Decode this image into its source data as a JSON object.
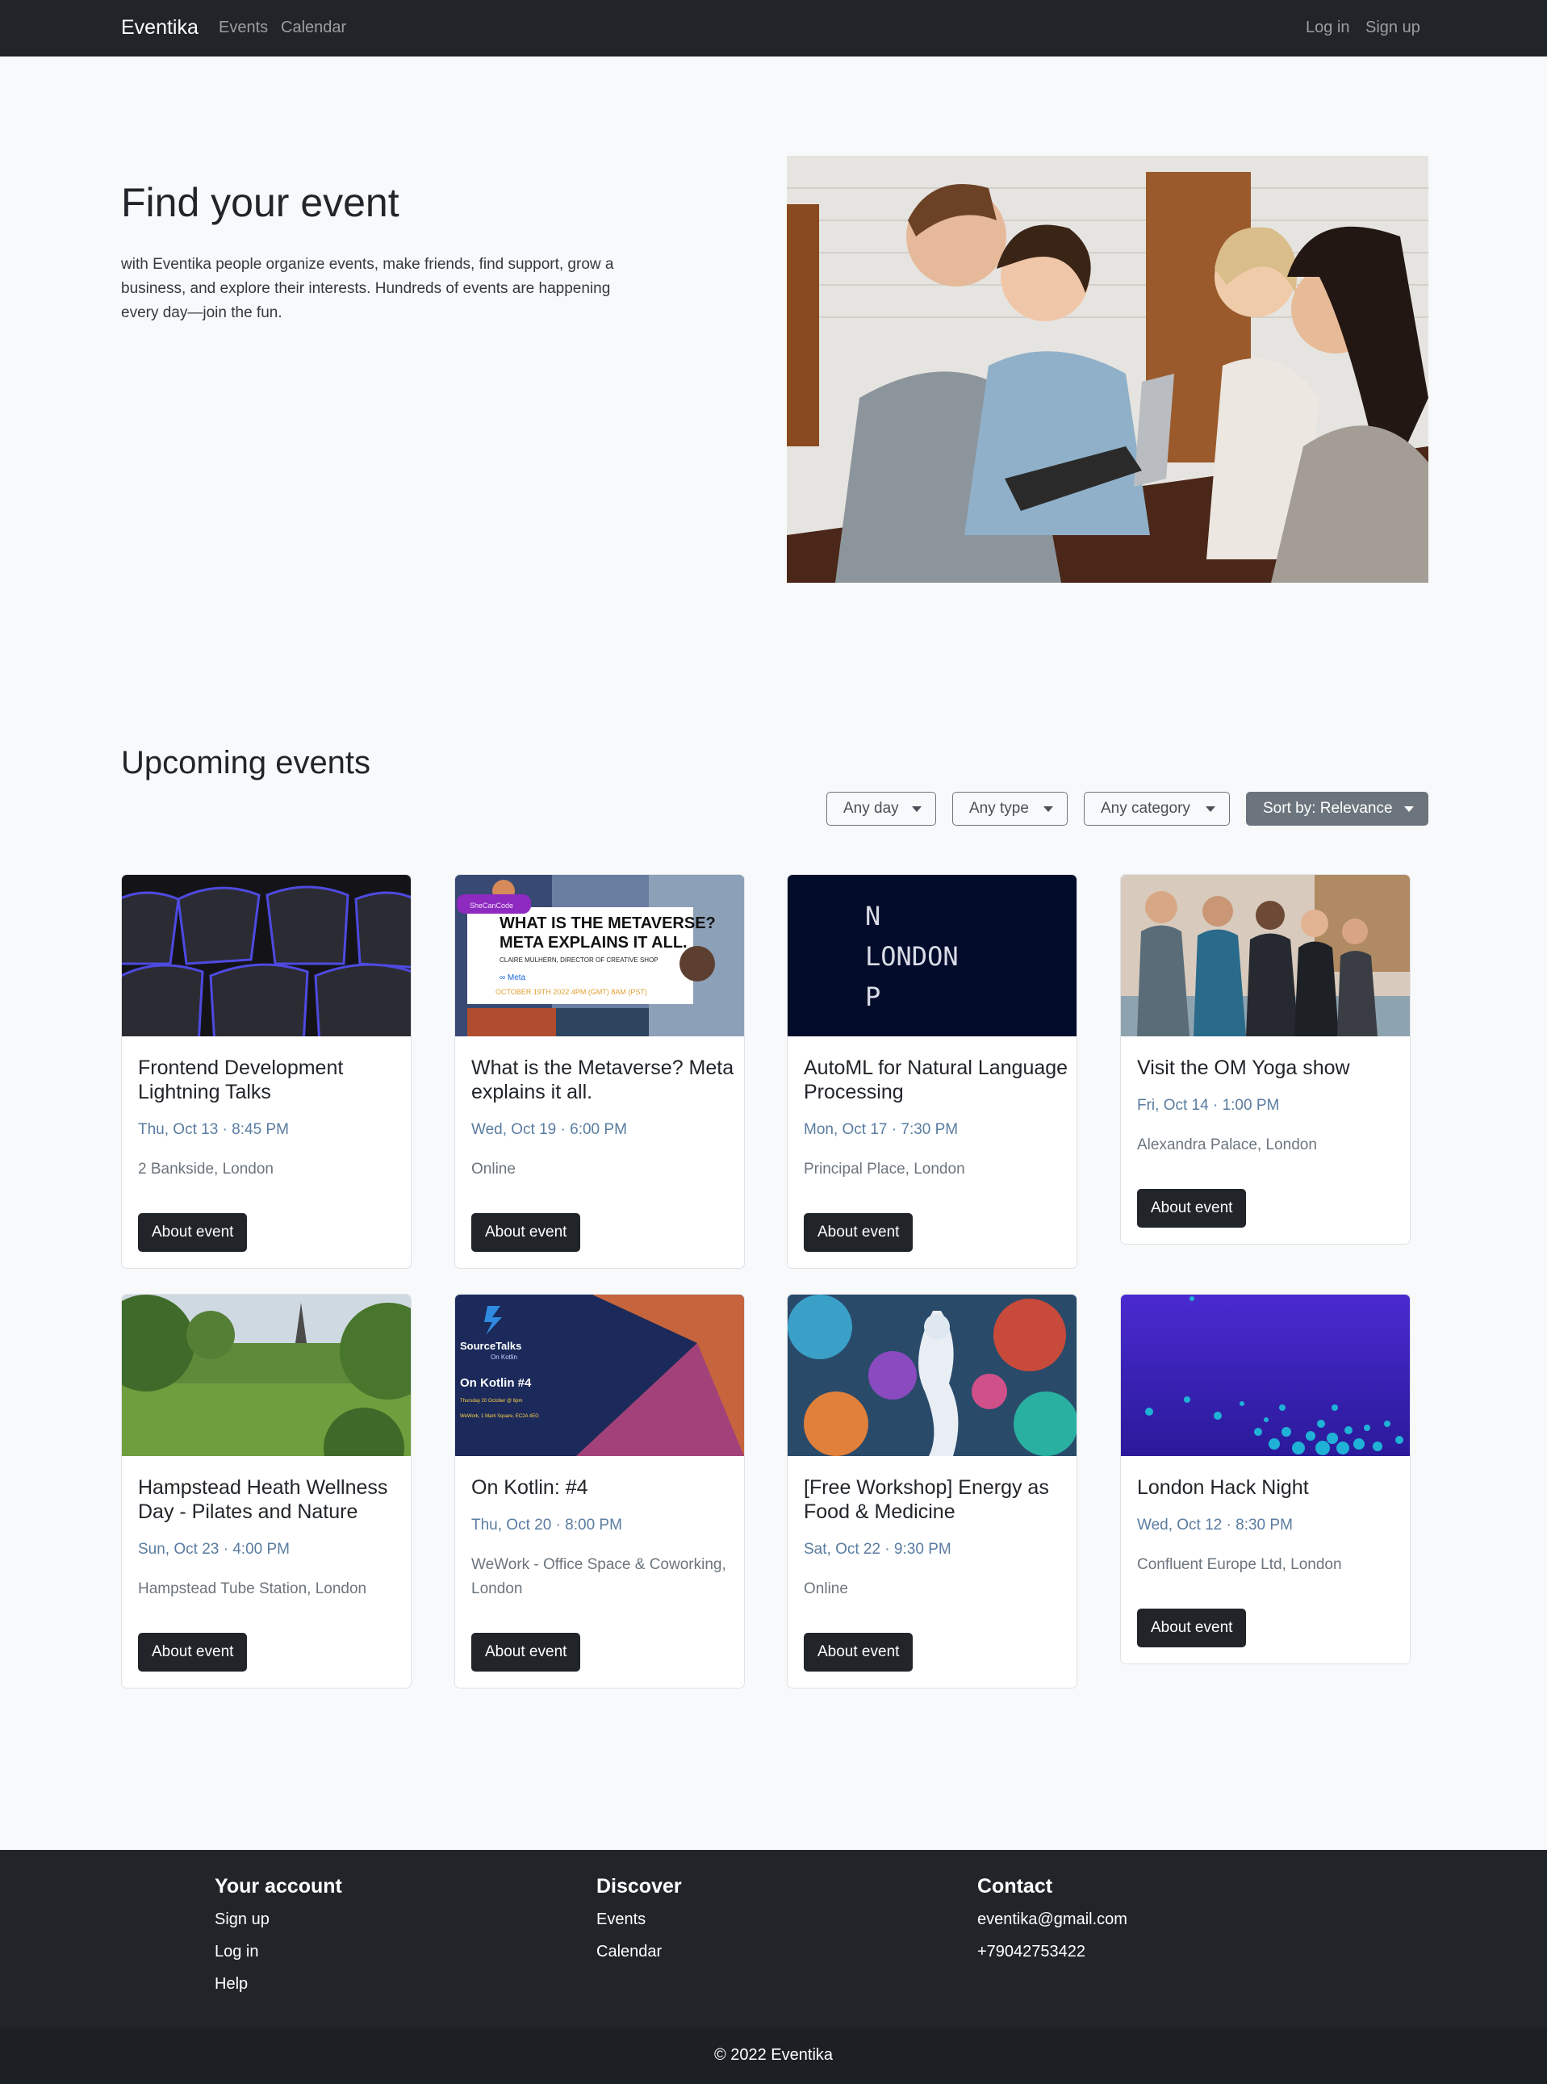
{
  "navbar": {
    "brand": "Eventika",
    "links": [
      "Events",
      "Calendar"
    ],
    "login": "Log in",
    "signup": "Sign up"
  },
  "hero": {
    "title": "Find your event",
    "text": "with Eventika people organize events, make friends, find support, grow a business, and explore their interests. Hundreds of events are happening every day—join the fun."
  },
  "upcoming": {
    "title": "Upcoming events",
    "filters": [
      "Any day",
      "Any type",
      "Any category",
      "Sort by: Relevance"
    ]
  },
  "events": [
    {
      "title": "Frontend Development Lightning Talks",
      "date": "Thu, Oct 13 · 8:45 PM",
      "place": "2 Bankside, London",
      "button": "About event"
    },
    {
      "title": "What is the Metaverse? Meta explains it all.",
      "date": "Wed, Oct 19 · 6:00 PM",
      "place": "Online",
      "button": "About event",
      "image_text": {
        "badge": "SheCanCode",
        "headline1": "WHAT IS THE METAVERSE?",
        "headline2": "META EXPLAINS IT ALL.",
        "speaker": "CLAIRE MULHERN, DIRECTOR OF CREATIVE SHOP",
        "brand": "∞ Meta",
        "when": "OCTOBER 19TH 2022 4PM (GMT) 8AM (PST)"
      }
    },
    {
      "title": "AutoML for Natural Language Processing",
      "date": "Mon, Oct 17 · 7:30 PM",
      "place": "Principal Place, London",
      "button": "About event",
      "image_text": {
        "line1": "N",
        "line2": "LONDON",
        "line3": "P"
      }
    },
    {
      "title": "Visit the OM Yoga show",
      "date": "Fri, Oct 14 · 1:00 PM",
      "place": "Alexandra Palace, London",
      "button": "About event"
    },
    {
      "title": "Hampstead Heath Wellness Day - Pilates and Nature",
      "date": "Sun, Oct 23 · 4:00 PM",
      "place": "Hampstead Tube Station, London",
      "button": "About event"
    },
    {
      "title": "On Kotlin: #4",
      "date": "Thu, Oct 20 · 8:00 PM",
      "place": "WeWork - Office Space & Coworking, London",
      "button": "About event",
      "image_text": {
        "brand": "SourceTalks",
        "sub": "On Kotlin",
        "title": "On Kotlin #4",
        "when": "Thursday 20 October @ 6pm",
        "where": "WeWork, 1 Mark Square, EC2A 4EG"
      }
    },
    {
      "title": "[Free Workshop] Energy as Food & Medicine",
      "date": "Sat, Oct 22 · 9:30 PM",
      "place": "Online",
      "button": "About event"
    },
    {
      "title": "London Hack Night",
      "date": "Wed, Oct 12 · 8:30 PM",
      "place": "Confluent Europe Ltd, London",
      "button": "About event"
    }
  ],
  "footer": {
    "account": {
      "title": "Your account",
      "links": [
        "Sign up",
        "Log in",
        "Help"
      ]
    },
    "discover": {
      "title": "Discover",
      "links": [
        "Events",
        "Calendar"
      ]
    },
    "contact": {
      "title": "Contact",
      "email": "eventika@gmail.com",
      "phone": "+79042753422"
    },
    "copyright": "© 2022 Eventika"
  }
}
